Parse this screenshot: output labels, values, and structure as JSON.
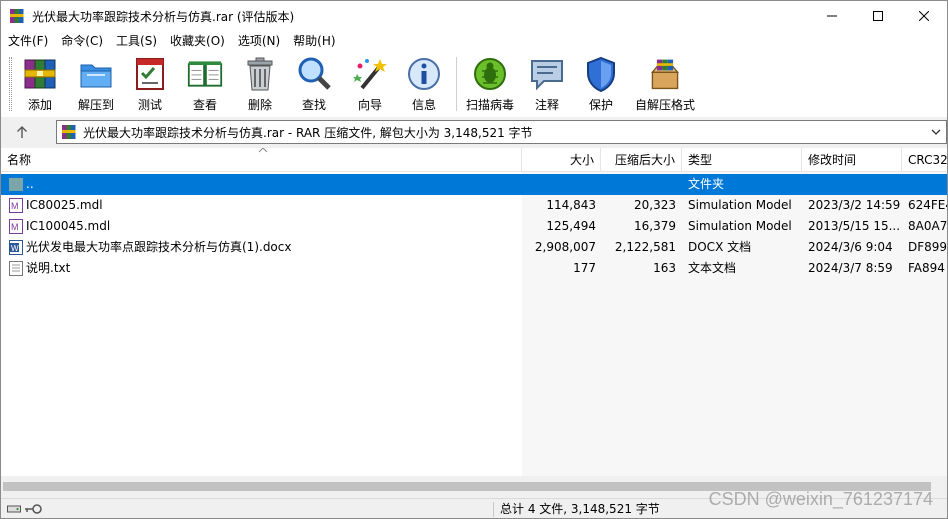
{
  "window": {
    "title": "光伏最大功率跟踪技术分析与仿真.rar (评估版本)",
    "controls": [
      "minimize",
      "maximize",
      "close"
    ]
  },
  "menu": [
    "文件(F)",
    "命令(C)",
    "工具(S)",
    "收藏夹(O)",
    "选项(N)",
    "帮助(H)"
  ],
  "toolbar": [
    {
      "label": "添加",
      "icon": "add-archive-icon"
    },
    {
      "label": "解压到",
      "icon": "extract-folder-icon"
    },
    {
      "label": "测试",
      "icon": "test-checklist-icon"
    },
    {
      "label": "查看",
      "icon": "view-book-icon"
    },
    {
      "label": "删除",
      "icon": "trash-can-icon"
    },
    {
      "label": "查找",
      "icon": "magnifier-icon"
    },
    {
      "label": "向导",
      "icon": "wizard-wand-icon"
    },
    {
      "label": "信息",
      "icon": "info-icon"
    },
    {
      "label": "扫描病毒",
      "icon": "virus-scan-icon"
    },
    {
      "label": "注释",
      "icon": "comment-icon"
    },
    {
      "label": "保护",
      "icon": "shield-icon"
    },
    {
      "label": "自解压格式",
      "icon": "sfx-box-icon"
    }
  ],
  "address": {
    "text": "光伏最大功率跟踪技术分析与仿真.rar - RAR 压缩文件, 解包大小为 3,148,521 字节"
  },
  "columns": [
    "名称",
    "大小",
    "压缩后大小",
    "类型",
    "修改时间",
    "CRC32"
  ],
  "files": [
    {
      "name": "..",
      "size": "",
      "packed": "",
      "type": "文件夹",
      "modified": "",
      "crc": "",
      "icon": "folder-up-icon",
      "selected": true
    },
    {
      "name": "IC80025.mdl",
      "size": "114,843",
      "packed": "20,323",
      "type": "Simulation Model",
      "modified": "2023/3/2 14:59",
      "crc": "624FE4",
      "icon": "mdl-file-icon",
      "selected": false
    },
    {
      "name": "IC100045.mdl",
      "size": "125,494",
      "packed": "16,379",
      "type": "Simulation Model",
      "modified": "2013/5/15 15...",
      "crc": "8A0A7",
      "icon": "mdl-file-icon",
      "selected": false
    },
    {
      "name": "光伏发电最大功率点跟踪技术分析与仿真(1).docx",
      "size": "2,908,007",
      "packed": "2,122,581",
      "type": "DOCX 文档",
      "modified": "2024/3/6 9:04",
      "crc": "DF899",
      "icon": "word-file-icon",
      "selected": false
    },
    {
      "name": "说明.txt",
      "size": "177",
      "packed": "163",
      "type": "文本文档",
      "modified": "2024/3/7 8:59",
      "crc": "FA894",
      "icon": "text-file-icon",
      "selected": false
    }
  ],
  "status": {
    "summary": "总计 4 文件, 3,148,521 字节"
  },
  "watermark": "CSDN @weixin_761237174",
  "colors": {
    "selection": "#0078d7",
    "background": "#ffffff"
  }
}
